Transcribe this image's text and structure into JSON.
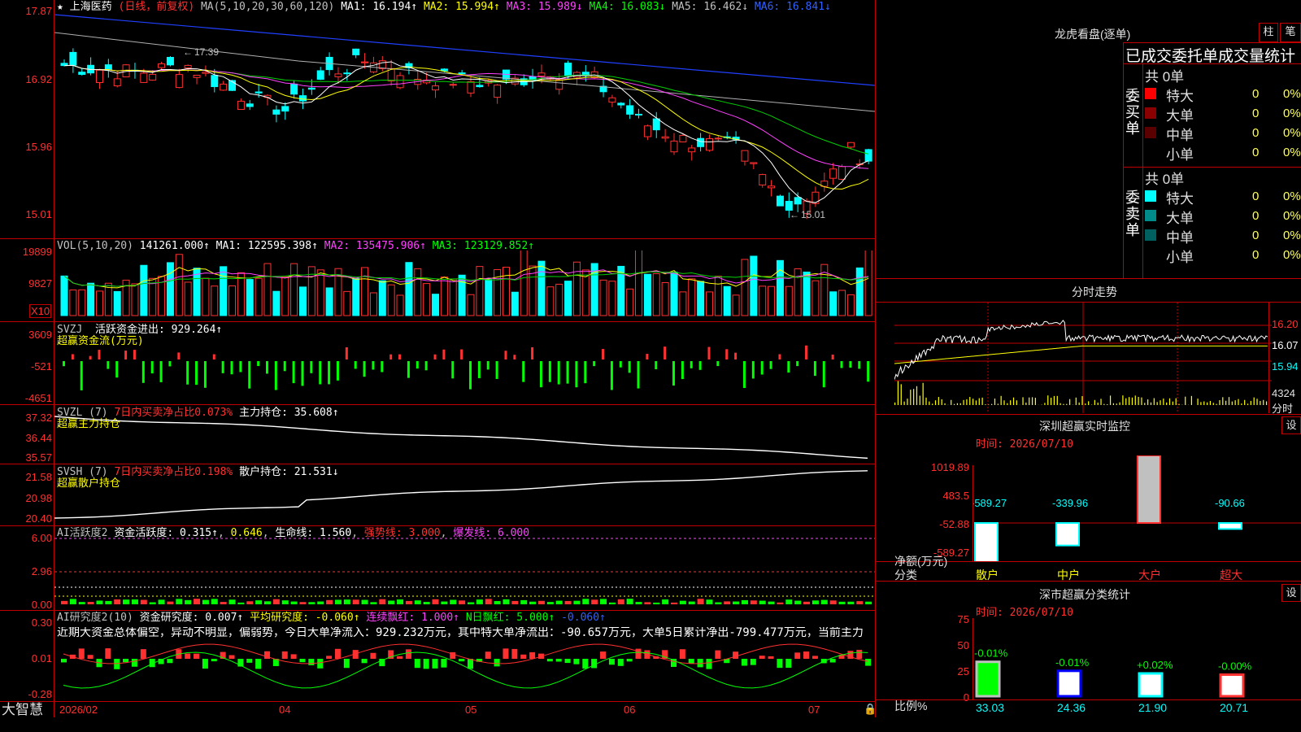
{
  "header": {
    "stock_name": "上海医药",
    "period": "(日线，前复权)",
    "ma_label": "MA(5,10,20,30,60,120)",
    "ma1": "MA1: 16.194↑",
    "ma2": "MA2: 15.994↑",
    "ma3": "MA3: 15.989↓",
    "ma4": "MA4: 16.083↓",
    "ma5": "MA5: 16.462↓",
    "ma6": "MA6: 16.841↓"
  },
  "price_axis": [
    "17.87",
    "16.92",
    "15.96",
    "15.01"
  ],
  "price_annotations": {
    "high": "17.39",
    "low": "15.01"
  },
  "vol": {
    "label": "VOL(5,10,20)",
    "value": "141261.000↑",
    "ma1": "MA1: 122595.398↑",
    "ma2": "MA2: 135475.906↑",
    "ma3": "MA3: 123129.852↑",
    "axis": [
      "19899",
      "9827"
    ],
    "unit": "X10"
  },
  "svzj": {
    "label": "SVZJ",
    "desc": "活跃资金进出: 929.264↑",
    "sub": "超赢资金流(万元)",
    "axis": [
      "3609",
      "-521",
      "-4651"
    ]
  },
  "svzl": {
    "label": "SVZL (7)",
    "desc_red": "7日内买卖净占比0.073%",
    "desc": "主力持仓: 35.608↑",
    "sub": "超赢主力持仓",
    "axis": [
      "37.32",
      "36.44",
      "35.57"
    ]
  },
  "svsh": {
    "label": "SVSH (7)",
    "desc_red": "7日内买卖净占比0.198%",
    "desc": "散户持仓: 21.531↓",
    "sub": "超赢散户持仓",
    "axis": [
      "21.58",
      "20.98",
      "20.40"
    ]
  },
  "ai_active": {
    "label": "AI活跃度2",
    "desc": "资金活跃度: 0.315↑",
    "v2": "0.646",
    "life": "生命线: 1.560",
    "strong": "强势线: 3.000",
    "burst": "爆发线: 6.000",
    "axis": [
      "6.00",
      "2.96",
      "0.00"
    ]
  },
  "ai_research": {
    "label": "AI研究度2(10)",
    "desc": "资金研究度: 0.007↑",
    "avg": "平均研究度: -0.060↑",
    "cont": "连续飘红: 1.000↑",
    "nday": "N日飘红: 5.000↑",
    "v5": "-0.060↑",
    "summary": "近期大资金总体偏空，异动不明显，偏弱势，今日大单净流入：929.232万元，其中特大单净流出：-90.657万元，大单5日累计净出-799.477万元，当前主力",
    "axis": [
      "0.30",
      "0.01",
      "-0.28"
    ]
  },
  "bottom": {
    "brand": "大智慧",
    "dates": [
      "2026/02",
      "04",
      "05",
      "06",
      "07"
    ]
  },
  "dragon": {
    "title": "龙虎看盘(逐单)",
    "btn_bar": "柱",
    "btn_pen": "笔",
    "subtitle": "已成交委托单成交量统计",
    "buy_group": "委买单",
    "sell_group": "委卖单",
    "buy_total": "共 0单",
    "sell_total": "共 0单",
    "rows": [
      {
        "name": "特大",
        "count": "0",
        "pct": "0%"
      },
      {
        "name": "大单",
        "count": "0",
        "pct": "0%"
      },
      {
        "name": "中单",
        "count": "0",
        "pct": "0%"
      },
      {
        "name": "小单",
        "count": "0",
        "pct": "0%"
      }
    ],
    "colors": {
      "buy": [
        "#ff0000",
        "#8b0000",
        "#5a0000"
      ],
      "sell": [
        "#00ffff",
        "#008b8b",
        "#006060"
      ]
    }
  },
  "intraday": {
    "title": "分时走势",
    "axis": [
      "16.20",
      "16.07",
      "15.94"
    ],
    "vol_axis": "4324",
    "vol_label": "分时"
  },
  "monitor": {
    "title": "深圳超赢实时监控",
    "btn": "设",
    "time": "时间: 2026/07/10",
    "axis": [
      "1019.89",
      "483.5",
      "-52.88",
      "-589.27"
    ],
    "values_label": [
      "-589.27",
      "-339.96",
      "1019.89",
      "-90.66"
    ],
    "row_label1": "净额(万元)",
    "row_label2": "分类",
    "categories": [
      "散户",
      "中户",
      "大户",
      "超大"
    ]
  },
  "classify": {
    "title": "深市超赢分类统计",
    "btn": "设",
    "time": "时间: 2026/07/10",
    "axis": [
      "75",
      "50",
      "25",
      "0"
    ],
    "changes": [
      "-0.01%",
      "-0.01%",
      "+0.02%",
      "-0.00%"
    ],
    "values": [
      "33.03",
      "24.36",
      "21.90",
      "20.71"
    ],
    "row_label1": "比例%",
    "row_label2": "分类",
    "categories": [
      "散户",
      "中户",
      "大户",
      "超大"
    ]
  },
  "chart_data": {
    "type": "candlestick",
    "title": "上海医药",
    "series_colors": {
      "up": "#ff3030",
      "down": "#00ffff"
    },
    "ylim": [
      15.01,
      17.87
    ]
  }
}
